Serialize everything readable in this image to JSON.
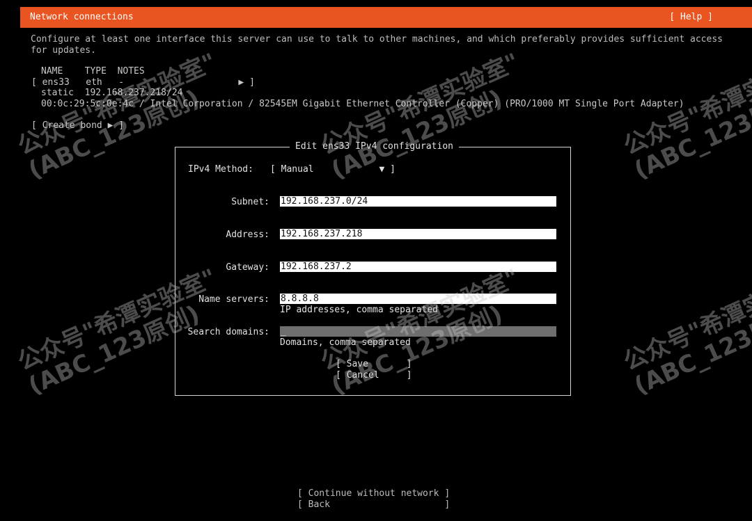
{
  "header": {
    "title": "Network connections",
    "help": "[ Help ]",
    "color": "#e95420"
  },
  "intro": "Configure at least one interface this server can use to talk to other machines, and which preferably provides sufficient access for updates.",
  "interfaces": {
    "columns_line": "NAME    TYPE  NOTES",
    "row_line": "[ ens33   eth   -                     ▶ ]",
    "static_line": "static  192.168.237.218/24",
    "hw_line": "00:0c:29:5c:0e:4c / Intel Corporation / 82545EM Gigabit Ethernet Controller (Copper) (PRO/1000 MT Single Port Adapter)"
  },
  "create_bond": "[ Create bond ▶ ]",
  "dialog": {
    "title": "Edit ens33 IPv4 configuration",
    "method_label": "IPv4 Method:",
    "method_value": "[ Manual            ▼ ]",
    "subnet_label": "Subnet:",
    "subnet_value": "192.168.237.0/24",
    "address_label": "Address:",
    "address_value": "192.168.237.218",
    "gateway_label": "Gateway:",
    "gateway_value": "192.168.237.2",
    "nameservers_label": "Name servers:",
    "nameservers_value": "8.8.8.8",
    "nameservers_hint": "IP addresses, comma separated",
    "search_label": "Search domains:",
    "search_value": "_",
    "search_hint": "Domains, comma separated",
    "save": "[ Save       ]",
    "cancel": "[ Cancel     ]"
  },
  "footer": {
    "continue": "[ Continue without network ]",
    "back": "[ Back                     ]"
  },
  "watermark": "公众号\"希潭实验室\"\n(ABC_123原创)"
}
